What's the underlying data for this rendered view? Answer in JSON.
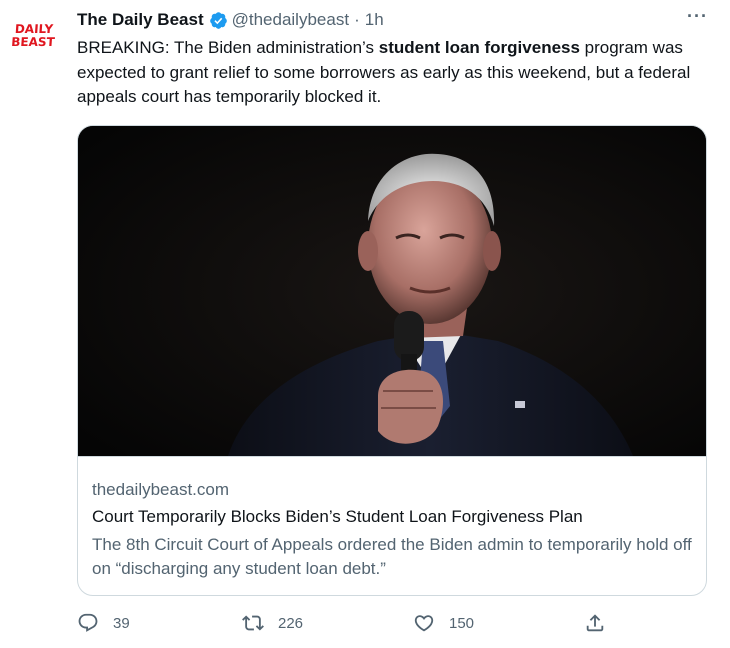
{
  "tweet": {
    "avatar_lines": [
      "DAILY",
      "BEAST"
    ],
    "display_name": "The Daily Beast",
    "handle": "@thedailybeast",
    "separator": "·",
    "time": "1h",
    "more_label": "···",
    "text_before": "BREAKING: The Biden administration’s ",
    "text_bold": "student loan forgiveness",
    "text_after": " program was expected to grant relief to some borrowers as early as this weekend, but a federal appeals court has temporarily blocked it."
  },
  "card": {
    "domain": "thedailybeast.com",
    "title": "Court Temporarily Blocks Biden’s Student Loan Forgiveness Plan",
    "description": "The 8th Circuit Court of Appeals ordered the Biden admin to temporarily hold off on “discharging any student loan debt.”"
  },
  "actions": {
    "reply_count": "39",
    "retweet_count": "226",
    "like_count": "150"
  },
  "icons": {
    "verified": "verified-badge-icon",
    "reply": "reply-icon",
    "retweet": "retweet-icon",
    "like": "heart-icon",
    "share": "share-icon"
  },
  "colors": {
    "brand_red": "#e0161f",
    "verified_blue": "#1d9bf0",
    "secondary_text": "#536471"
  }
}
